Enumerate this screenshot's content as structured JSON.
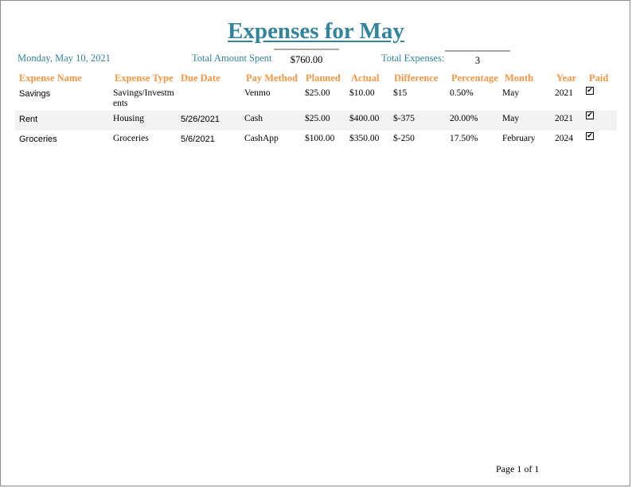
{
  "report": {
    "title": "Expenses for May",
    "date": "Monday, May 10, 2021",
    "total_spent_label": "Total Amount Spent",
    "total_spent_value": "$760.00",
    "total_expenses_label": "Total Expenses:",
    "total_expenses_value": "3"
  },
  "columns": [
    "Expense Name",
    "Expense Type",
    "Due Date",
    "Pay Method",
    "Planned",
    "Actual",
    "Difference",
    "Percentage",
    "Month",
    "Year",
    "Paid"
  ],
  "rows": [
    {
      "name": "Savings",
      "type": "Savings/Investments",
      "due": "",
      "method": "Venmo",
      "planned": "$25.00",
      "actual": "$10.00",
      "difference": "$15",
      "percentage": "0.50%",
      "month": "May",
      "year": "2021",
      "paid": "✔"
    },
    {
      "name": "Rent",
      "type": "Housing",
      "due": "5/26/2021",
      "method": "Cash",
      "planned": "$25.00",
      "actual": "$400.00",
      "difference": "$-375",
      "percentage": "20.00%",
      "month": "May",
      "year": "2021",
      "paid": "✔"
    },
    {
      "name": "Groceries",
      "type": "Groceries",
      "due": "5/6/2021",
      "method": "CashApp",
      "planned": "$100.00",
      "actual": "$350.00",
      "difference": "$-250",
      "percentage": "17.50%",
      "month": "February",
      "year": "2024",
      "paid": "✔"
    }
  ],
  "footer": {
    "page": "Page 1 of 1"
  }
}
